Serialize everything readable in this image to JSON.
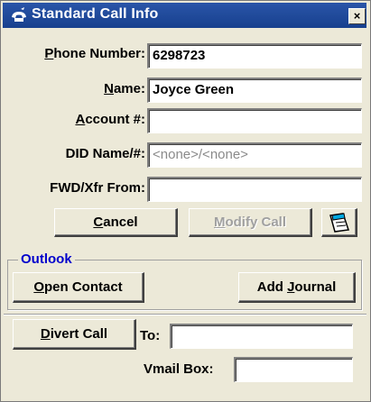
{
  "window": {
    "title": "Standard Call Info",
    "close_glyph": "×",
    "title_icon": "phone-icon"
  },
  "fields": {
    "phone_number": {
      "label_underlined": "P",
      "label_rest": "hone Number:",
      "value": "6298723"
    },
    "name": {
      "label_underlined": "N",
      "label_rest": "ame:",
      "value": "Joyce Green"
    },
    "account": {
      "label_underlined": "A",
      "label_rest": "ccount #:",
      "value": ""
    },
    "did": {
      "label": "DID Name/#:",
      "value": "<none>/<none>"
    },
    "fwd_xfr": {
      "label": "FWD/Xfr From:",
      "value": ""
    }
  },
  "buttons": {
    "cancel": {
      "label_underlined": "C",
      "label_rest": "ancel"
    },
    "modify_call": {
      "label_underlined": "M",
      "label_rest": "odify Call"
    },
    "notes_icon": "notepad-icon"
  },
  "outlook": {
    "group_title": "Outlook",
    "open_contact": {
      "label_underlined": "O",
      "label_rest": "pen Contact"
    },
    "add_journal": {
      "label_before": "Add ",
      "label_underlined": "J",
      "label_rest": "ournal"
    }
  },
  "divert": {
    "button": {
      "label_underlined": "D",
      "label_rest": "ivert Call"
    },
    "to_label": "To:",
    "to_value": "",
    "vmail_label": "Vmail Box:",
    "vmail_value": ""
  },
  "colors": {
    "titlebar": "#17408e",
    "dialog_bg": "#ece9d8",
    "group_title": "#0000cc"
  }
}
